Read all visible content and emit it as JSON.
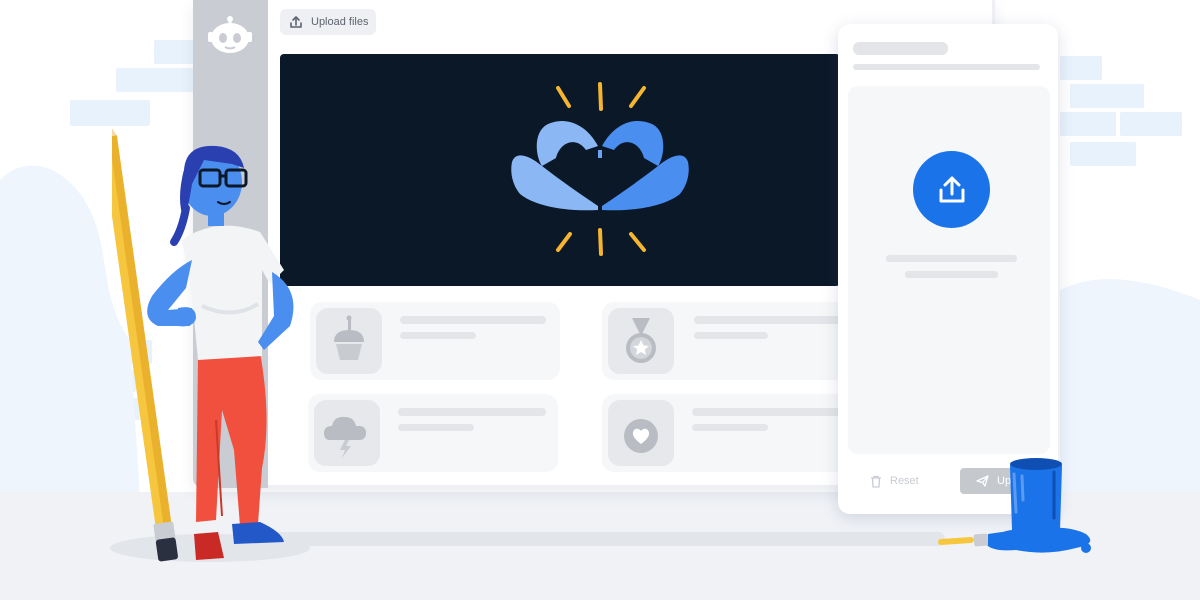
{
  "toolbar": {
    "upload_files_label": "Upload files"
  },
  "panel": {
    "reset_label": "Reset",
    "upload_label": "Upload"
  },
  "cards": [
    {
      "icon": "cupcake-icon"
    },
    {
      "icon": "medal-icon"
    },
    {
      "icon": "storm-cloud-icon"
    },
    {
      "icon": "heart-icon"
    }
  ],
  "colors": {
    "accent": "#1a73e8",
    "hero_bg": "#0b1828",
    "pencil": "#f7c63f",
    "pants": "#f0503d",
    "character_skin": "#4a8ef0"
  }
}
